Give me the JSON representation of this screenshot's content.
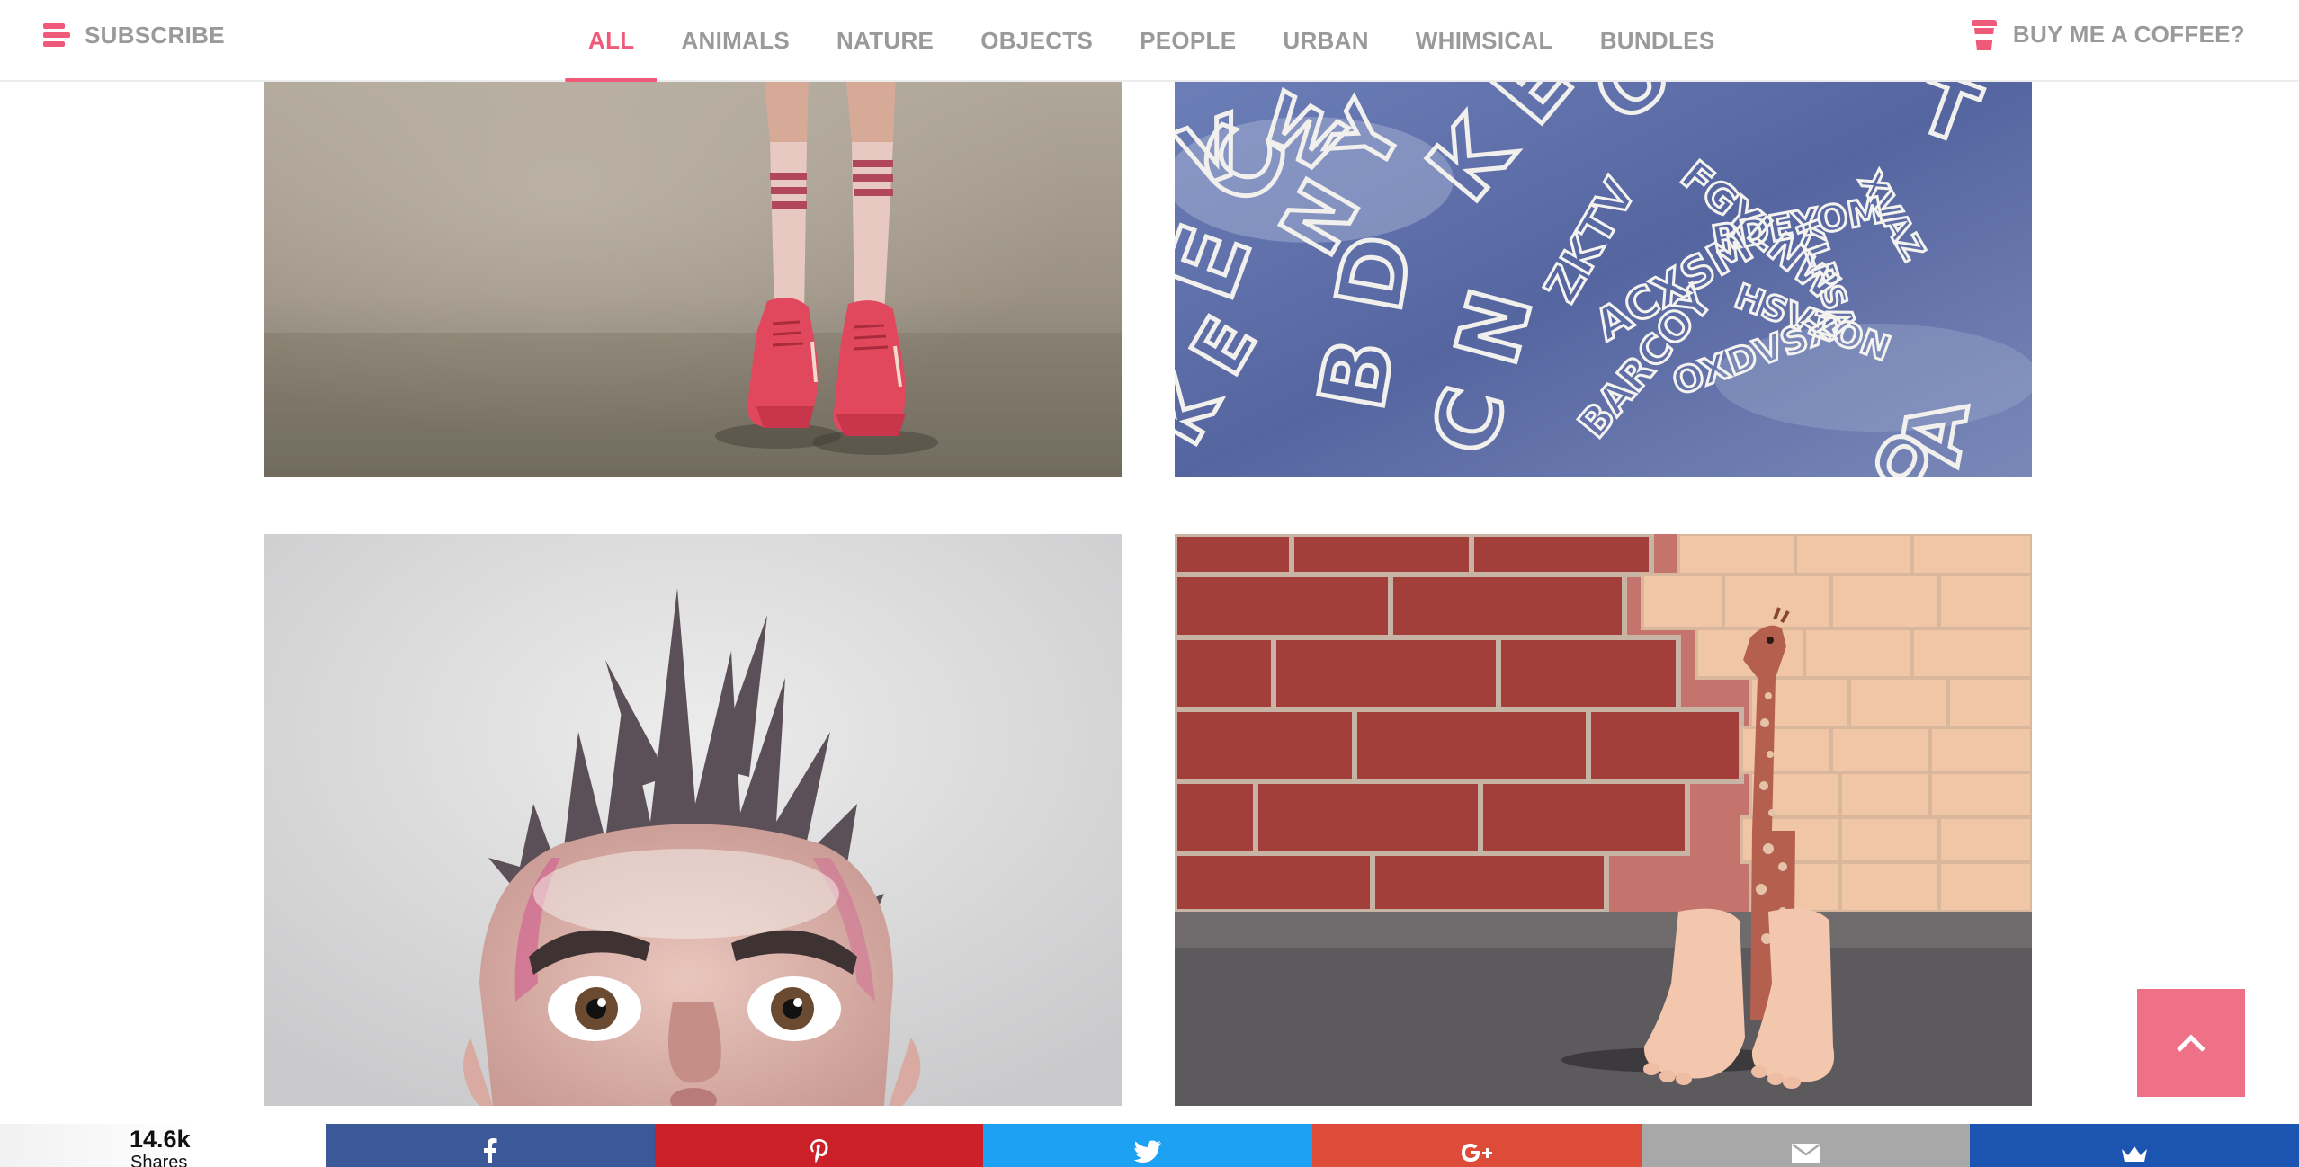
{
  "header": {
    "subscribe_label": "SUBSCRIBE",
    "coffee_label": "BUY ME A COFFEE?",
    "nav": [
      {
        "label": "ALL",
        "active": true
      },
      {
        "label": "ANIMALS"
      },
      {
        "label": "NATURE"
      },
      {
        "label": "OBJECTS"
      },
      {
        "label": "PEOPLE"
      },
      {
        "label": "URBAN"
      },
      {
        "label": "WHIMSICAL"
      },
      {
        "label": "BUNDLES"
      }
    ]
  },
  "gallery": {
    "photos": [
      {
        "subject": "red sneakers and striped knee socks"
      },
      {
        "subject": "metal letter sculpture against blue sky"
      },
      {
        "subject": "surprised man with spiky hair"
      },
      {
        "subject": "toy giraffe wearing feet slippers by brick wall"
      }
    ]
  },
  "share": {
    "count": "14.6k",
    "count_label": "Shares",
    "buttons": [
      {
        "network": "facebook",
        "icon": "facebook-icon",
        "color": "#3b5998"
      },
      {
        "network": "pinterest",
        "icon": "pinterest-icon",
        "color": "#cb2027"
      },
      {
        "network": "twitter",
        "icon": "twitter-icon",
        "color": "#1da1f2"
      },
      {
        "network": "google-plus",
        "icon": "google-plus-icon",
        "color": "#dd4b39"
      },
      {
        "network": "email",
        "icon": "email-icon",
        "color": "#a8a8a8"
      },
      {
        "network": "sumome",
        "icon": "crown-icon",
        "color": "#1c54b2"
      }
    ]
  },
  "colors": {
    "accent": "#ef5a7a",
    "nav_text": "#9a9a9a",
    "back_to_top": "#ef7187"
  }
}
